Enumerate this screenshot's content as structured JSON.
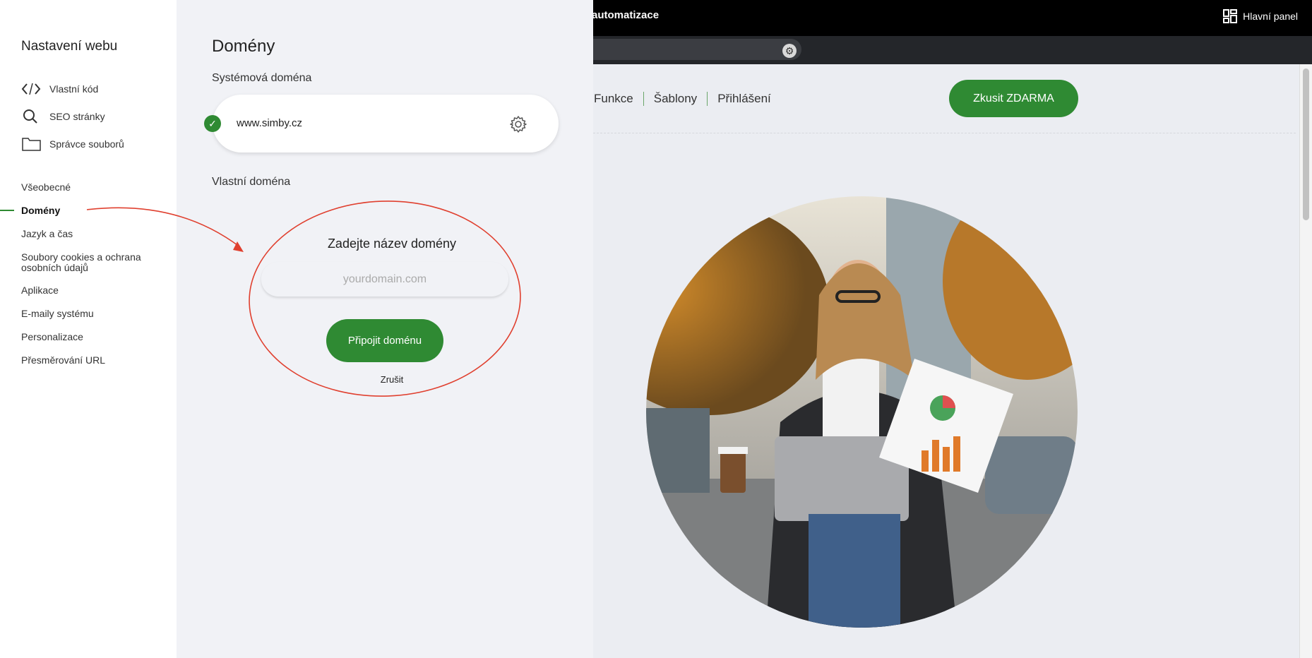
{
  "topbar": {
    "brand": "automatizace",
    "dashboard_label": "Hlavní panel"
  },
  "site": {
    "nav": [
      "Funkce",
      "Šablony",
      "Přihlášení"
    ],
    "cta": "Zkusit ZDARMA"
  },
  "sidebar": {
    "title": "Nastavení webu",
    "tools": [
      {
        "label": "Vlastní kód",
        "icon": "code-icon"
      },
      {
        "label": "SEO stránky",
        "icon": "search-icon"
      },
      {
        "label": "Správce souborů",
        "icon": "folder-icon"
      }
    ],
    "items": [
      {
        "label": "Všeobecné",
        "active": false
      },
      {
        "label": "Domény",
        "active": true
      },
      {
        "label": "Jazyk a čas",
        "active": false
      },
      {
        "label": "Soubory cookies a ochrana osobních údajů",
        "active": false
      },
      {
        "label": "Aplikace",
        "active": false
      },
      {
        "label": "E-maily systému",
        "active": false
      },
      {
        "label": "Personalizace",
        "active": false
      },
      {
        "label": "Přesměrování URL",
        "active": false
      }
    ]
  },
  "domains": {
    "title": "Domény",
    "system_label": "Systémová doména",
    "system_domain": "www.simby.cz",
    "custom_label": "Vlastní doména",
    "enter_title": "Zadejte název domény",
    "input_placeholder": "yourdomain.com",
    "connect_label": "Připojit doménu",
    "cancel_label": "Zrušit"
  },
  "colors": {
    "accent": "#2f8a33",
    "annotation": "#e0402f"
  }
}
